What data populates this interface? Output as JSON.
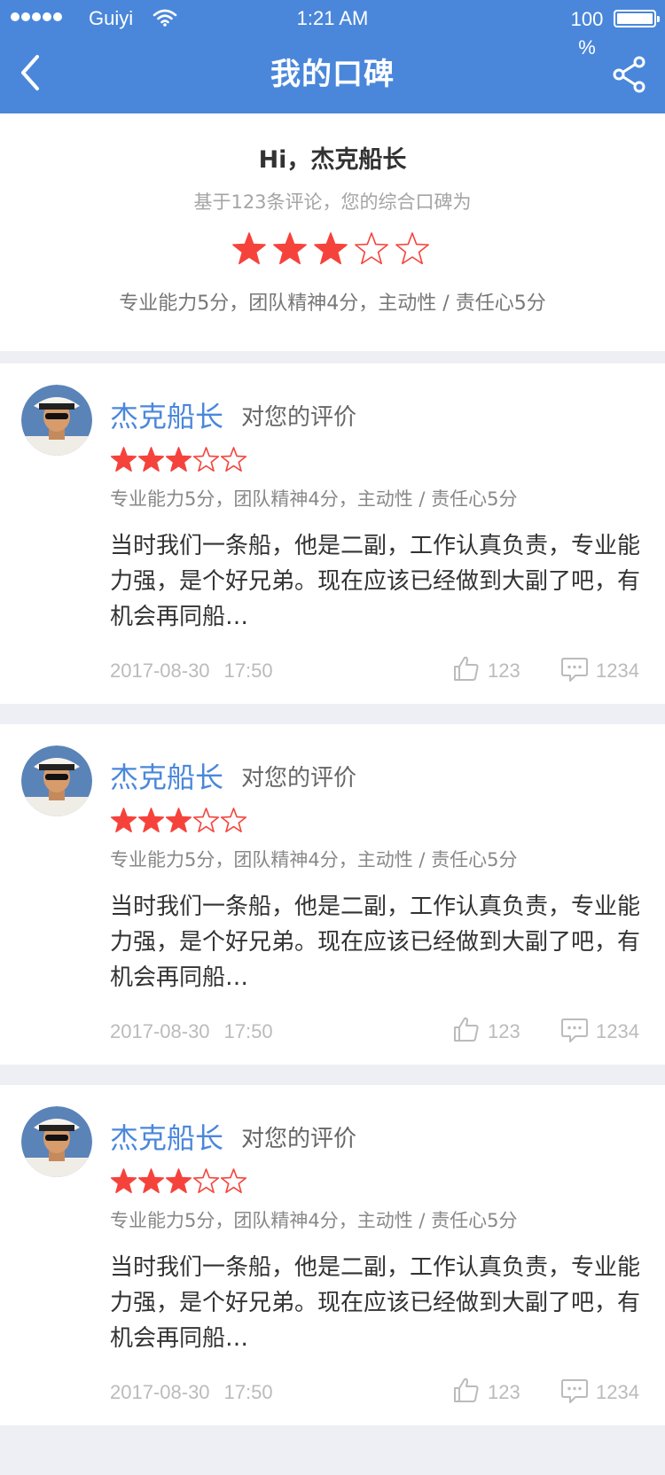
{
  "status_bar": {
    "carrier": "Guiyi",
    "time": "1:21 AM",
    "battery": "100 %"
  },
  "nav": {
    "title": "我的口碑",
    "back_icon": "chevron-left-icon",
    "share_icon": "share-icon"
  },
  "summary": {
    "greeting": "Hi，杰克船长",
    "basis": "基于123条评论，您的综合口碑为",
    "rating": 3,
    "max_rating": 5,
    "scores": "专业能力5分，团队精神4分，主动性 / 责任心5分"
  },
  "colors": {
    "brand_blue": "#4a87db",
    "star_red": "#f5433c",
    "background": "#eeeff4"
  },
  "reviews": [
    {
      "reviewer": "杰克船长",
      "evaluate_label": "对您的评价",
      "rating": 3,
      "scores": "专业能力5分，团队精神4分，主动性 / 责任心5分",
      "comment": "当时我们一条船，他是二副，工作认真负责，专业能力强，是个好兄弟。现在应该已经做到大副了吧，有机会再同船…",
      "date": "2017-08-30",
      "time": "17:50",
      "likes": "123",
      "comments": "1234"
    },
    {
      "reviewer": "杰克船长",
      "evaluate_label": "对您的评价",
      "rating": 3,
      "scores": "专业能力5分，团队精神4分，主动性 / 责任心5分",
      "comment": "当时我们一条船，他是二副，工作认真负责，专业能力强，是个好兄弟。现在应该已经做到大副了吧，有机会再同船…",
      "date": "2017-08-30",
      "time": "17:50",
      "likes": "123",
      "comments": "1234"
    },
    {
      "reviewer": "杰克船长",
      "evaluate_label": "对您的评价",
      "rating": 3,
      "scores": "专业能力5分，团队精神4分，主动性 / 责任心5分",
      "comment": "当时我们一条船，他是二副，工作认真负责，专业能力强，是个好兄弟。现在应该已经做到大副了吧，有机会再同船…",
      "date": "2017-08-30",
      "time": "17:50",
      "likes": "123",
      "comments": "1234"
    }
  ]
}
